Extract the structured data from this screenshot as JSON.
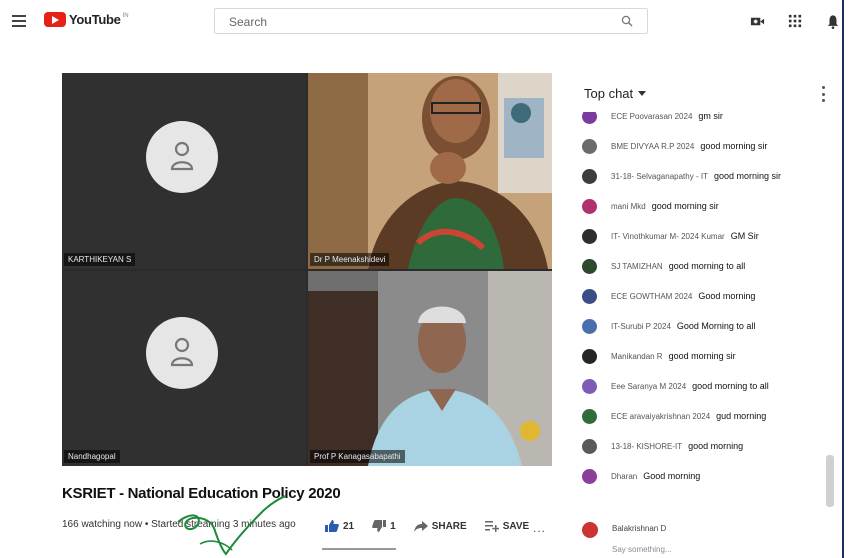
{
  "header": {
    "logo_text": "YouTube",
    "logo_country": "IN",
    "search_placeholder": "Search",
    "icons": [
      "menu-icon",
      "youtube-logo",
      "search-icon",
      "create-video-icon",
      "apps-grid-icon",
      "notifications-bell-icon"
    ]
  },
  "video": {
    "participants": [
      {
        "name": "KARTHIKEYAN S",
        "video": false
      },
      {
        "name": "Dr P Meenakshidevi",
        "video": true
      },
      {
        "name": "Nandhagopal",
        "video": false
      },
      {
        "name": "Prof P Kanagasabapathi",
        "video": true
      }
    ],
    "title": "KSRIET - National Education Policy 2020",
    "meta": "166 watching now • Started streaming 3 minutes ago",
    "likes": "21",
    "dislikes": "1",
    "share_label": "SHARE",
    "save_label": "SAVE",
    "more_label": "..."
  },
  "chat": {
    "header": "Top chat",
    "messages": [
      {
        "author": "ECE Poovarasan 2024",
        "text": "gm sir",
        "color": "#7a3a9e"
      },
      {
        "author": "BME DIVYAA R.P 2024",
        "text": "good morning sir",
        "color": "#6b6b6b"
      },
      {
        "author": "31-18- Selvaganapathy - IT",
        "text": "good morning sir",
        "color": "#3d3d3d"
      },
      {
        "author": "mani Mkd",
        "text": "good morning sir",
        "color": "#b0316d"
      },
      {
        "author": "IT- Vinothkumar M- 2024 Kumar",
        "text": "GM Sir",
        "color": "#2e2e2e"
      },
      {
        "author": "SJ TAMIZHAN",
        "text": "good morning to all",
        "color": "#2d4a2e"
      },
      {
        "author": "ECE GOWTHAM 2024",
        "text": "Good morning",
        "color": "#3a4f86"
      },
      {
        "author": "IT-Surubi P 2024",
        "text": "Good Morning to all",
        "color": "#4a6fae"
      },
      {
        "author": "Manikandan R",
        "text": "good morning sir",
        "color": "#262626"
      },
      {
        "author": "Eee Saranya M 2024",
        "text": "good morning to all",
        "color": "#7c5cb4"
      },
      {
        "author": "ECE aravaiyakrishnan 2024",
        "text": "gud morning",
        "color": "#2f6d3a"
      },
      {
        "author": "13-18- KISHORE-IT",
        "text": "good morning",
        "color": "#5a5a5a"
      },
      {
        "author": "Dharan",
        "text": "Good morning",
        "color": "#8a3f9a"
      }
    ],
    "composer_name": "Balakrishnan D",
    "composer_placeholder": "Say something..."
  }
}
